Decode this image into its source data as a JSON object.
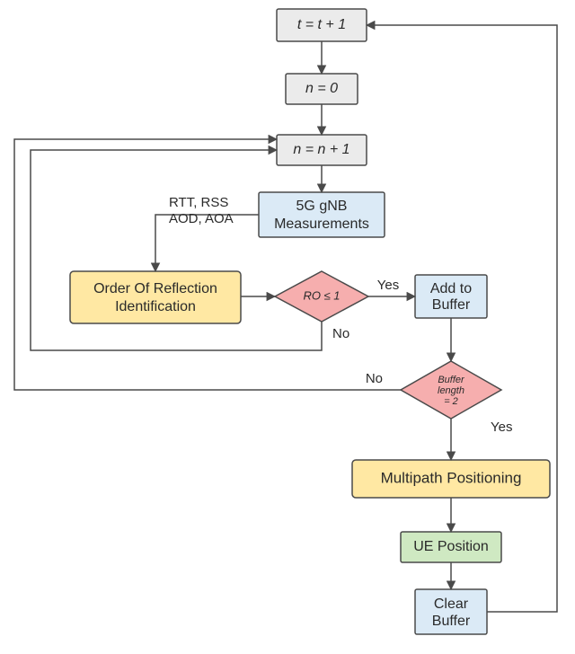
{
  "chart_data": {
    "type": "flowchart",
    "nodes": [
      {
        "id": "inc_t",
        "label": "t = t + 1",
        "shape": "process",
        "fill": "gray"
      },
      {
        "id": "n_zero",
        "label": "n = 0",
        "shape": "process",
        "fill": "gray"
      },
      {
        "id": "inc_n",
        "label": "n = n + 1",
        "shape": "process",
        "fill": "gray"
      },
      {
        "id": "meas",
        "label": "5G gNB\nMeasurements",
        "shape": "process",
        "fill": "blue"
      },
      {
        "id": "oori",
        "label": "Order Of Reflection\nIdentification",
        "shape": "process",
        "fill": "yellow"
      },
      {
        "id": "d_ro",
        "label": "RO ≤ 1",
        "shape": "decision",
        "fill": "pink"
      },
      {
        "id": "addbuf",
        "label": "Add to\nBuffer",
        "shape": "process",
        "fill": "blue"
      },
      {
        "id": "d_buf",
        "label": "Buffer\nlength\n= 2",
        "shape": "decision",
        "fill": "pink"
      },
      {
        "id": "multipath",
        "label": "Multipath Positioning",
        "shape": "process",
        "fill": "yellow"
      },
      {
        "id": "uepos",
        "label": "UE Position",
        "shape": "process",
        "fill": "green"
      },
      {
        "id": "clear",
        "label": "Clear\nBuffer",
        "shape": "process",
        "fill": "blue"
      }
    ],
    "edges": [
      {
        "from": "inc_t",
        "to": "n_zero"
      },
      {
        "from": "n_zero",
        "to": "inc_n"
      },
      {
        "from": "inc_n",
        "to": "meas"
      },
      {
        "from": "meas",
        "to": "oori",
        "label": "RTT, RSS\nAOD, AOA"
      },
      {
        "from": "oori",
        "to": "d_ro"
      },
      {
        "from": "d_ro",
        "to": "addbuf",
        "label": "Yes"
      },
      {
        "from": "d_ro",
        "to": "inc_n",
        "label": "No"
      },
      {
        "from": "addbuf",
        "to": "d_buf"
      },
      {
        "from": "d_buf",
        "to": "multipath",
        "label": "Yes"
      },
      {
        "from": "d_buf",
        "to": "inc_n",
        "label": "No"
      },
      {
        "from": "multipath",
        "to": "uepos"
      },
      {
        "from": "uepos",
        "to": "clear"
      },
      {
        "from": "clear",
        "to": "inc_t"
      }
    ]
  },
  "nodes": {
    "inc_t": "t = t + 1",
    "n_zero": "n = 0",
    "inc_n": "n = n + 1",
    "meas_l1": "5G gNB",
    "meas_l2": "Measurements",
    "oori_l1": "Order Of Reflection",
    "oori_l2": "Identification",
    "d_ro": "RO ≤ 1",
    "addbuf_l1": "Add to",
    "addbuf_l2": "Buffer",
    "d_buf_l1": "Buffer",
    "d_buf_l2": "length",
    "d_buf_l3": "= 2",
    "multipath": "Multipath Positioning",
    "uepos": "UE Position",
    "clear_l1": "Clear",
    "clear_l2": "Buffer"
  },
  "edgeLabels": {
    "meas_to_oori_l1": "RTT, RSS",
    "meas_to_oori_l2": "AOD, AOA",
    "ro_yes": "Yes",
    "ro_no": "No",
    "buf_yes": "Yes",
    "buf_no": "No"
  }
}
